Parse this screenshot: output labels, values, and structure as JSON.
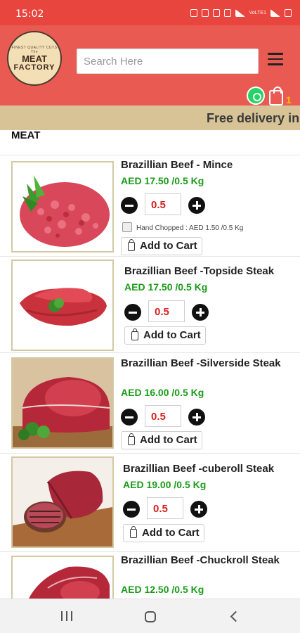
{
  "status_bar": {
    "time": "15:02",
    "network_label": "VoLTE1"
  },
  "header": {
    "logo": {
      "tagline": "FINEST QUALITY CUTS",
      "line1": "The",
      "line2": "MEAT",
      "line3": "FACTORY"
    },
    "search_placeholder": "Search Here",
    "cart_count": "1"
  },
  "banner": {
    "text": "Free delivery in"
  },
  "section": {
    "title": "MEAT"
  },
  "products": [
    {
      "name": "Brazillian Beef - Mince",
      "price": "AED 17.50 /0.5 Kg",
      "qty": "0.5",
      "add_label": "Add to Cart",
      "option_label": "Hand Chopped : AED 1.50 /0.5 Kg"
    },
    {
      "name": "Brazillian Beef -Topside Steak",
      "price": "AED 17.50 /0.5 Kg",
      "qty": "0.5",
      "add_label": "Add to Cart"
    },
    {
      "name": "Brazillian Beef -Silverside Steak",
      "price": "AED 16.00 /0.5 Kg",
      "qty": "0.5",
      "add_label": "Add to Cart"
    },
    {
      "name": "Brazillian Beef -cuberoll Steak",
      "price": "AED 19.00 /0.5 Kg",
      "qty": "0.5",
      "add_label": "Add to Cart"
    },
    {
      "name": "Brazillian Beef -Chuckroll Steak",
      "price": "AED 12.50 /0.5 Kg"
    }
  ],
  "icons": {
    "menu": "hamburger-menu-icon",
    "whatsapp": "whatsapp-icon",
    "cart": "shopping-bag-icon",
    "minus": "minus-circle-icon",
    "plus": "plus-circle-icon"
  },
  "colors": {
    "header_bg": "#e85a52",
    "status_bg": "#e8453e",
    "banner_bg": "#d8c397",
    "price": "#1a9b1a",
    "qty_text": "#d81f1f",
    "cart_count": "#f5c400"
  }
}
